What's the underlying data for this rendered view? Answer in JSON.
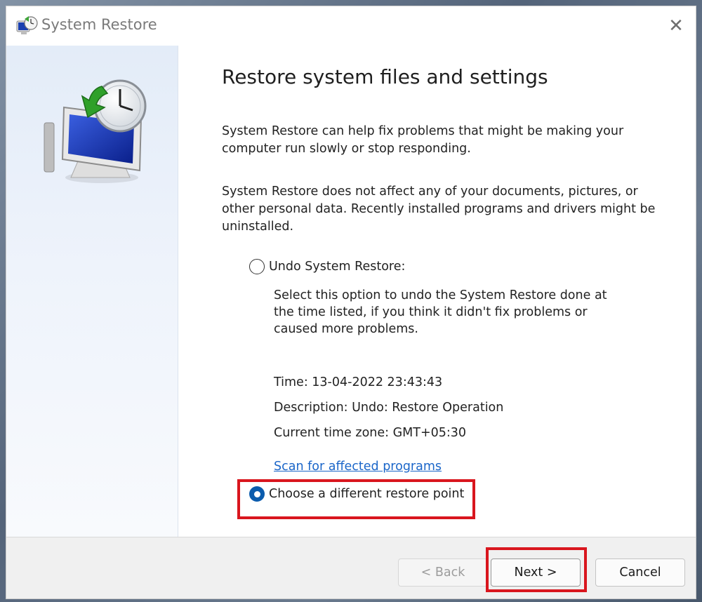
{
  "window": {
    "title": "System Restore",
    "title_icon": "system-restore-icon",
    "close_icon": "close-icon",
    "close_glyph": "✕"
  },
  "sidebar": {
    "illustration": "system-restore-illustration"
  },
  "main": {
    "heading": "Restore system files and settings",
    "paragraph1": "System Restore can help fix problems that might be making your computer run slowly or stop responding.",
    "paragraph2": "System Restore does not affect any of your documents, pictures, or other personal data. Recently installed programs and drivers might be uninstalled.",
    "undo_option": {
      "label": "Undo System Restore:",
      "selected": false,
      "description": "Select this option to undo the System Restore done at the time listed, if you think it didn't fix problems or caused more problems.",
      "time": "Time: 13-04-2022 23:43:43",
      "desc": "Description: Undo: Restore Operation",
      "timezone": "Current time zone: GMT+05:30"
    },
    "scan_link": "Scan for affected programs",
    "choose_option": {
      "label": "Choose a different restore point",
      "selected": true
    }
  },
  "footer": {
    "back_label": "< Back",
    "next_label": "Next >",
    "cancel_label": "Cancel"
  },
  "colors": {
    "accent": "#0b5cad",
    "link": "#1b66c9",
    "highlight": "#d9161e"
  }
}
